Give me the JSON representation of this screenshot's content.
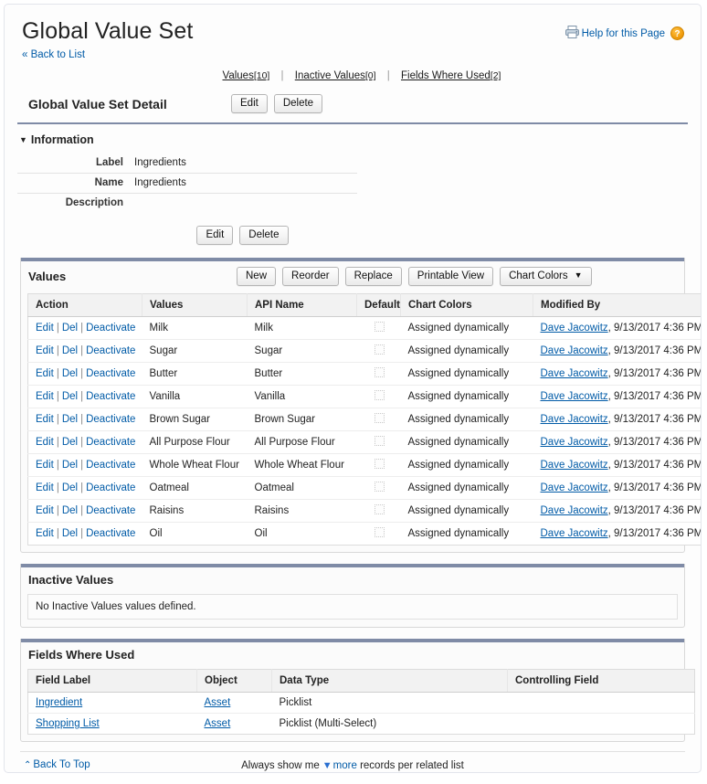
{
  "header": {
    "title": "Global Value Set",
    "back_to_list": "« Back to List",
    "printer_icon": "printer-icon",
    "help_text": "Help for this Page",
    "help_badge": "?"
  },
  "related_nav": {
    "items": [
      {
        "label": "Values",
        "count": "[10]"
      },
      {
        "label": "Inactive Values",
        "count": "[0]"
      },
      {
        "label": "Fields Where Used",
        "count": "[2]"
      }
    ],
    "separator": "|"
  },
  "detail": {
    "title": "Global Value Set Detail",
    "edit_label": "Edit",
    "delete_label": "Delete"
  },
  "information": {
    "section_title": "Information",
    "twisty": "▼",
    "fields": [
      {
        "label": "Label",
        "value": "Ingredients"
      },
      {
        "label": "Name",
        "value": "Ingredients"
      },
      {
        "label": "Description",
        "value": ""
      }
    ],
    "edit_label": "Edit",
    "delete_label": "Delete"
  },
  "values_panel": {
    "title": "Values",
    "buttons": [
      {
        "label": "New",
        "caret": false
      },
      {
        "label": "Reorder",
        "caret": false
      },
      {
        "label": "Replace",
        "caret": false
      },
      {
        "label": "Printable View",
        "caret": false
      },
      {
        "label": "Chart Colors",
        "caret": true
      }
    ],
    "caret_glyph": "▼",
    "columns": [
      "Action",
      "Values",
      "API Name",
      "Default",
      "Chart Colors",
      "Modified By"
    ],
    "action_labels": {
      "edit": "Edit",
      "del": "Del",
      "deactivate": "Deactivate"
    },
    "rows": [
      {
        "value": "Milk",
        "api_name": "Milk",
        "default": false,
        "chart_colors": "Assigned dynamically",
        "modified_by_user": "Dave Jacowitz",
        "modified_date": ", 9/13/2017 4:36 PM"
      },
      {
        "value": "Sugar",
        "api_name": "Sugar",
        "default": false,
        "chart_colors": "Assigned dynamically",
        "modified_by_user": "Dave Jacowitz",
        "modified_date": ", 9/13/2017 4:36 PM"
      },
      {
        "value": "Butter",
        "api_name": "Butter",
        "default": false,
        "chart_colors": "Assigned dynamically",
        "modified_by_user": "Dave Jacowitz",
        "modified_date": ", 9/13/2017 4:36 PM"
      },
      {
        "value": "Vanilla",
        "api_name": "Vanilla",
        "default": false,
        "chart_colors": "Assigned dynamically",
        "modified_by_user": "Dave Jacowitz",
        "modified_date": ", 9/13/2017 4:36 PM"
      },
      {
        "value": "Brown Sugar",
        "api_name": "Brown Sugar",
        "default": false,
        "chart_colors": "Assigned dynamically",
        "modified_by_user": "Dave Jacowitz",
        "modified_date": ", 9/13/2017 4:36 PM"
      },
      {
        "value": "All Purpose Flour",
        "api_name": "All Purpose Flour",
        "default": false,
        "chart_colors": "Assigned dynamically",
        "modified_by_user": "Dave Jacowitz",
        "modified_date": ", 9/13/2017 4:36 PM"
      },
      {
        "value": "Whole Wheat Flour",
        "api_name": "Whole Wheat Flour",
        "default": false,
        "chart_colors": "Assigned dynamically",
        "modified_by_user": "Dave Jacowitz",
        "modified_date": ", 9/13/2017 4:36 PM"
      },
      {
        "value": "Oatmeal",
        "api_name": "Oatmeal",
        "default": false,
        "chart_colors": "Assigned dynamically",
        "modified_by_user": "Dave Jacowitz",
        "modified_date": ", 9/13/2017 4:36 PM"
      },
      {
        "value": "Raisins",
        "api_name": "Raisins",
        "default": false,
        "chart_colors": "Assigned dynamically",
        "modified_by_user": "Dave Jacowitz",
        "modified_date": ", 9/13/2017 4:36 PM"
      },
      {
        "value": "Oil",
        "api_name": "Oil",
        "default": false,
        "chart_colors": "Assigned dynamically",
        "modified_by_user": "Dave Jacowitz",
        "modified_date": ", 9/13/2017 4:36 PM"
      }
    ]
  },
  "inactive_panel": {
    "title": "Inactive Values",
    "empty_message": "No Inactive Values values defined."
  },
  "fields_panel": {
    "title": "Fields Where Used",
    "columns": [
      "Field Label",
      "Object",
      "Data Type",
      "Controlling Field"
    ],
    "rows": [
      {
        "field_label": "Ingredient",
        "object": "Asset",
        "data_type": "Picklist",
        "controlling_field": ""
      },
      {
        "field_label": "Shopping List",
        "object": "Asset",
        "data_type": "Picklist (Multi-Select)",
        "controlling_field": ""
      }
    ]
  },
  "footer": {
    "back_to_top": "Back To Top",
    "chevron_up": "⌃",
    "show_prefix": "Always show me",
    "triangle": "▼",
    "more_label": "more",
    "show_suffix": "records per related list"
  },
  "colors": {
    "link": "#015ba7",
    "section_bar": "#7f8ba6",
    "help_badge": "#f3a011"
  }
}
